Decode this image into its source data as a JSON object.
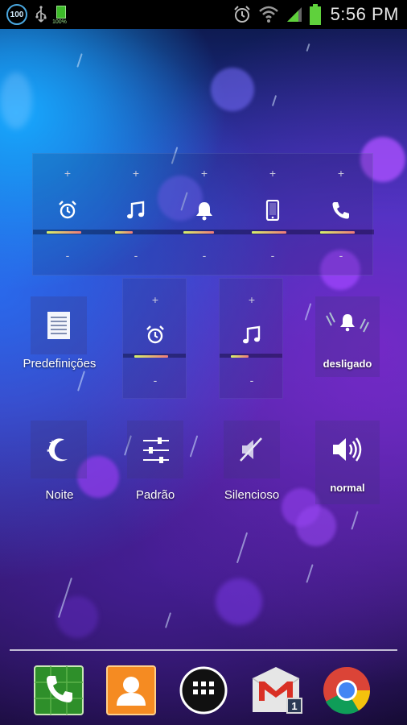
{
  "statusbar": {
    "left_badge": "100",
    "battery_small_pct": "100%",
    "time": "5:56 PM"
  },
  "volume_panel": {
    "columns": [
      {
        "plus": "+",
        "minus": "-",
        "icon": "alarm-clock-icon",
        "level": 0.72
      },
      {
        "plus": "+",
        "minus": "-",
        "icon": "music-note-icon",
        "level": 0.36
      },
      {
        "plus": "+",
        "minus": "-",
        "icon": "bell-icon",
        "level": 0.64
      },
      {
        "plus": "+",
        "minus": "-",
        "icon": "phone-device-icon",
        "level": 0.72
      },
      {
        "plus": "+",
        "minus": "-",
        "icon": "call-handset-icon",
        "level": 0.72
      }
    ]
  },
  "presets_tile": {
    "label": "Predefinições"
  },
  "mini_alarm": {
    "plus": "+",
    "minus": "-",
    "icon": "alarm-clock-icon",
    "level": 0.7
  },
  "mini_music": {
    "plus": "+",
    "minus": "-",
    "icon": "music-note-icon",
    "level": 0.36
  },
  "ringer_tile": {
    "label": "desligado"
  },
  "profiles": {
    "night": "Noite",
    "default": "Padrão",
    "silent": "Silencioso",
    "normal": "normal"
  },
  "dock": {
    "gmail_badge": "1"
  },
  "colors": {
    "bar_start": "#d6f26a",
    "bar_end": "#f07a7a"
  }
}
